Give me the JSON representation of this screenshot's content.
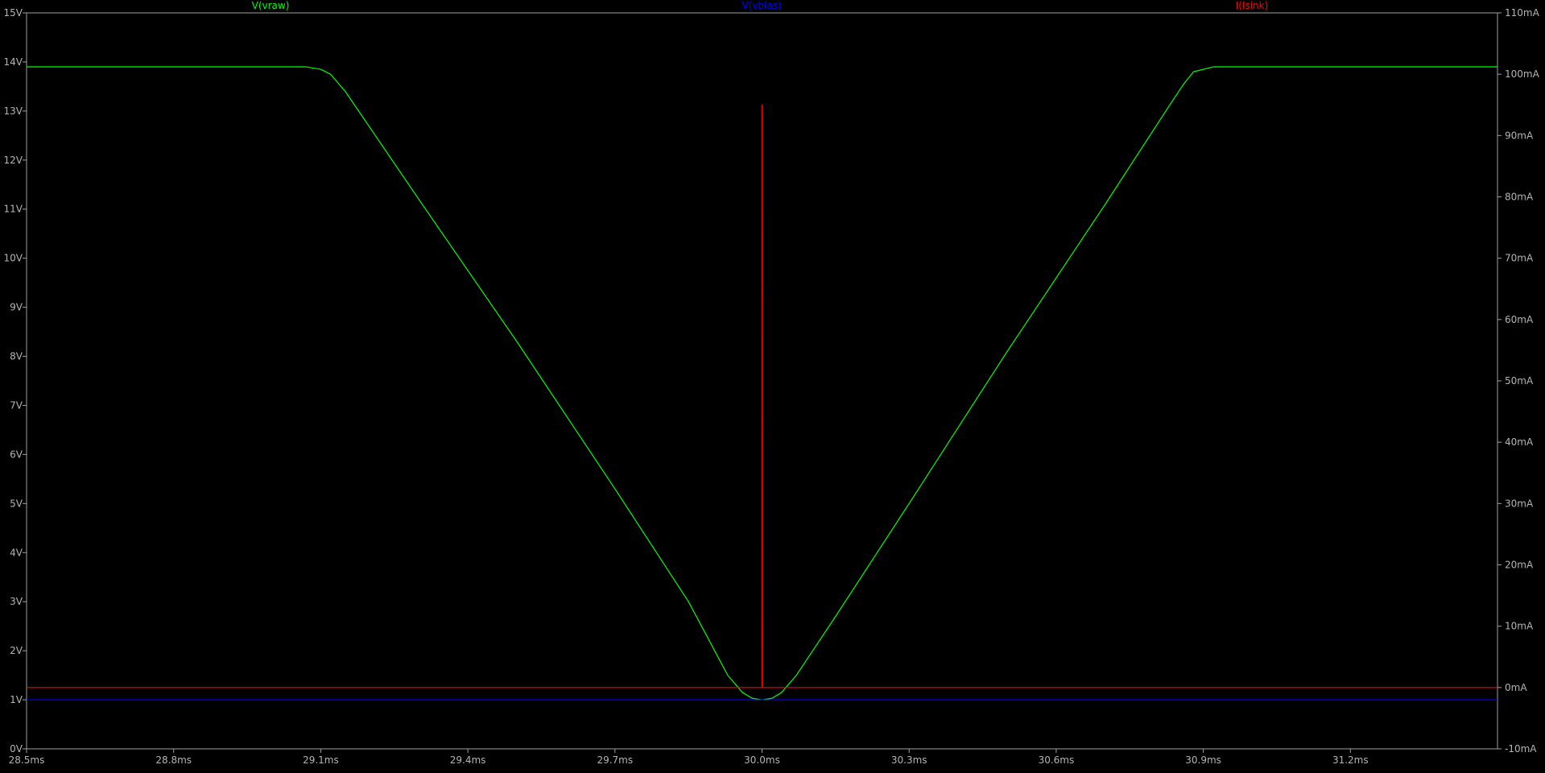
{
  "colors": {
    "background": "#000000",
    "axis": "#a0a0a0",
    "tick_label": "#b4b4b4",
    "vraw": "#00ff00",
    "vbias": "#0000ff",
    "isink": "#ff0000"
  },
  "legend": {
    "vraw": "V(vraw)",
    "vbias": "V(vbias)",
    "isink": "I(Isink)"
  },
  "chart_data": {
    "type": "line",
    "title": "",
    "xlabel": "",
    "ylabel": "",
    "y2label": "",
    "grid": false,
    "legend_position": "top",
    "x_unit": "ms",
    "xlim": [
      28.5,
      31.5
    ],
    "ylim": [
      0,
      15
    ],
    "y2lim": [
      -10,
      110
    ],
    "x_ticks": [
      "28.5ms",
      "28.8ms",
      "29.1ms",
      "29.4ms",
      "29.7ms",
      "30.0ms",
      "30.3ms",
      "30.6ms",
      "30.9ms",
      "31.2ms"
    ],
    "y_ticks": [
      "0V",
      "1V",
      "2V",
      "3V",
      "4V",
      "5V",
      "6V",
      "7V",
      "8V",
      "9V",
      "10V",
      "11V",
      "12V",
      "13V",
      "14V",
      "15V"
    ],
    "y2_ticks": [
      "-10mA",
      "0mA",
      "10mA",
      "20mA",
      "30mA",
      "40mA",
      "50mA",
      "60mA",
      "70mA",
      "80mA",
      "90mA",
      "100mA",
      "110mA"
    ],
    "series": [
      {
        "name": "V(vraw)",
        "axis": "left",
        "x": [
          28.5,
          28.9,
          29.07,
          29.1,
          29.12,
          29.15,
          29.3,
          29.5,
          29.7,
          29.85,
          29.93,
          29.96,
          29.98,
          30.0,
          30.02,
          30.04,
          30.07,
          30.15,
          30.3,
          30.5,
          30.7,
          30.83,
          30.86,
          30.88,
          30.92,
          31.0,
          31.5
        ],
        "y": [
          13.9,
          13.9,
          13.9,
          13.85,
          13.75,
          13.4,
          11.2,
          8.3,
          5.3,
          3.0,
          1.5,
          1.15,
          1.03,
          1.0,
          1.03,
          1.15,
          1.5,
          2.7,
          5.0,
          8.1,
          11.1,
          13.1,
          13.55,
          13.8,
          13.9,
          13.9,
          13.9
        ]
      },
      {
        "name": "V(vbias)",
        "axis": "left",
        "x": [
          28.5,
          31.5
        ],
        "y": [
          1.0,
          1.0
        ]
      },
      {
        "name": "I(Isink)",
        "axis": "right",
        "x": [
          28.5,
          29.999,
          30.0,
          30.0,
          30.001,
          31.5
        ],
        "y": [
          0,
          0,
          0,
          95,
          0,
          0
        ]
      }
    ]
  }
}
